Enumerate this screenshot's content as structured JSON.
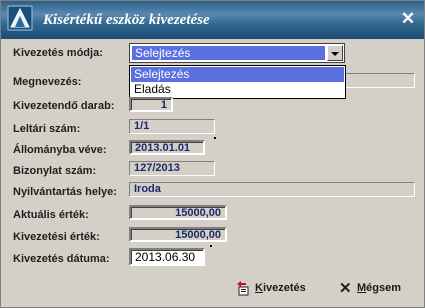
{
  "window": {
    "title": "Kisértékű eszköz kivezetése"
  },
  "form": {
    "mode": {
      "label": "Kivezetés módja:",
      "value": "Selejtezés",
      "options": [
        "Selejtezés",
        "Eladás"
      ],
      "highlighted": "Selejtezés"
    },
    "name": {
      "label": "Megnevezés:",
      "value": ""
    },
    "quantity": {
      "label": "Kivezetendő darab:",
      "value": "1"
    },
    "inventory_no": {
      "label": "Leltári szám:",
      "value": "1/1"
    },
    "stock_date": {
      "label": "Állományba véve:",
      "value": "2013.01.01"
    },
    "voucher_no": {
      "label": "Bizonylat szám:",
      "value": "127/2013"
    },
    "location": {
      "label": "Nyilvántartás helye:",
      "value": "Iroda"
    },
    "current_value": {
      "label": "Aktuális érték:",
      "value": "15000,00"
    },
    "disposal_value": {
      "label": "Kivezetési érték:",
      "value": "15000,00"
    },
    "disposal_date": {
      "label": "Kivezetés dátuma:",
      "value": "2013.06.30"
    }
  },
  "actions": {
    "confirm": {
      "pre": "",
      "key": "K",
      "rest": "ivezetés"
    },
    "cancel": {
      "pre": "",
      "key": "M",
      "rest": "égsem"
    }
  },
  "colors": {
    "title_bar": "#2c5f88",
    "highlight": "#5a6fe0",
    "field_text": "#1a2a6c"
  }
}
